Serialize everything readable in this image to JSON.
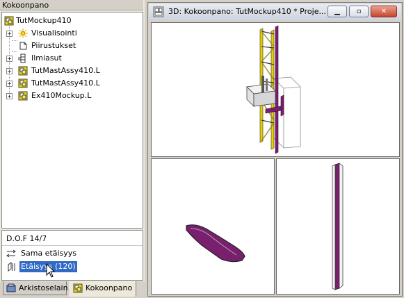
{
  "left_panel": {
    "header": "Kokoonpano",
    "tree": {
      "root": "TutMockup410",
      "items": [
        {
          "label": "Visualisointi",
          "icon": "sun-icon"
        },
        {
          "label": "Piirustukset",
          "icon": "drawing-icon"
        },
        {
          "label": "Ilmiasut",
          "icon": "layout-icon"
        },
        {
          "label": "TutMastAssy410.L",
          "icon": "assembly-icon"
        },
        {
          "label": "TutMastAssy410.L",
          "icon": "assembly-icon"
        },
        {
          "label": "Ex410Mockup.L",
          "icon": "assembly-icon"
        }
      ]
    },
    "dof": {
      "title": "D.O.F 14/7",
      "constraints": [
        {
          "label": "Sama etäisyys",
          "icon": "equal-distance-icon"
        },
        {
          "label": "Etäisyys (120)",
          "icon": "distance-icon",
          "selected": true
        }
      ]
    },
    "tabs": [
      {
        "label": "Arkistoselain",
        "icon": "archive-icon"
      },
      {
        "label": "Kokoonpano",
        "icon": "assembly-icon",
        "active": true
      }
    ]
  },
  "window": {
    "title": "3D: Kokoonpano: TutMockup410 *  Proje...",
    "buttons": {
      "minimize": "▁",
      "restore": "▫",
      "close": "✕"
    }
  },
  "colors": {
    "selection": "#316ac5",
    "steel_yellow": "#e5d100",
    "steel_purple": "#7a1f6e",
    "assembly_icon": "#e8d400"
  }
}
